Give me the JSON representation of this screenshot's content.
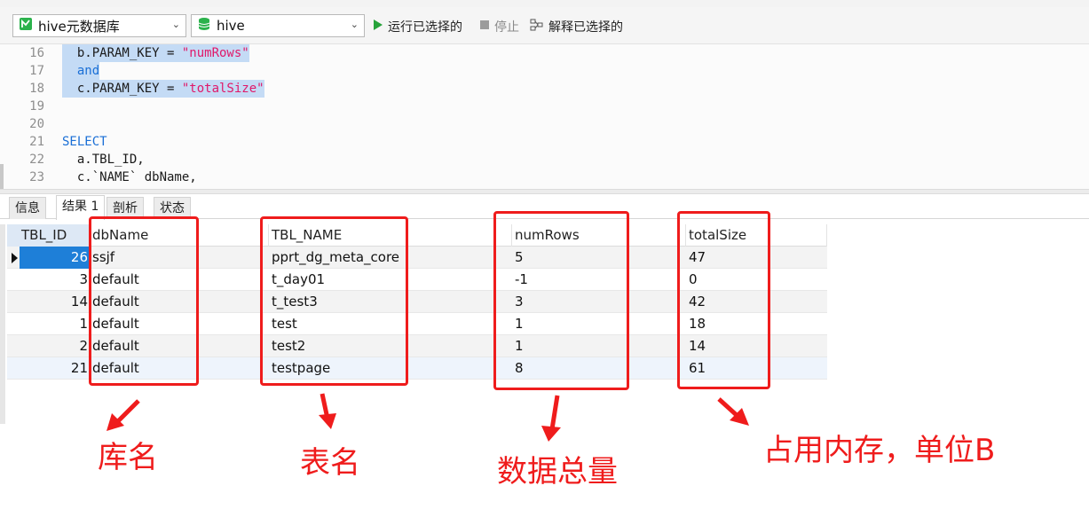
{
  "toolbar": {
    "connection_name": "hive元数据库",
    "database_name": "hive",
    "run_selected_label": "运行已选择的",
    "stop_label": "停止",
    "explain_selected_label": "解释已选择的"
  },
  "editor": {
    "lines": [
      {
        "num": "16",
        "parts": [
          {
            "t": "  b.PARAM_KEY = ",
            "c": ""
          },
          {
            "t": "\"numRows\"",
            "c": "str"
          }
        ],
        "highlight": true
      },
      {
        "num": "17",
        "parts": [
          {
            "t": "  and",
            "c": "kw"
          }
        ],
        "highlight": true
      },
      {
        "num": "18",
        "parts": [
          {
            "t": "  c.PARAM_KEY = ",
            "c": ""
          },
          {
            "t": "\"totalSize\"",
            "c": "str"
          }
        ],
        "highlight": true
      },
      {
        "num": "19",
        "parts": [],
        "highlight": false
      },
      {
        "num": "20",
        "parts": [],
        "highlight": false
      },
      {
        "num": "21",
        "parts": [
          {
            "t": "SELECT",
            "c": "kw"
          }
        ],
        "highlight": false
      },
      {
        "num": "22",
        "parts": [
          {
            "t": "  a.TBL_ID,",
            "c": ""
          }
        ],
        "highlight": false
      },
      {
        "num": "23",
        "parts": [
          {
            "t": "  c.`NAME` dbName,",
            "c": ""
          }
        ],
        "highlight": false
      }
    ]
  },
  "tabs": [
    "信息",
    "结果 1",
    "剖析",
    "状态"
  ],
  "active_tab": "结果 1",
  "grid": {
    "columns": [
      "TBL_ID",
      "dbName",
      "TBL_NAME",
      "numRows",
      "totalSize"
    ],
    "rows": [
      {
        "TBL_ID": "26",
        "dbName": "ssjf",
        "TBL_NAME": "pprt_dg_meta_core",
        "numRows": "5",
        "totalSize": "47"
      },
      {
        "TBL_ID": "3",
        "dbName": "default",
        "TBL_NAME": "t_day01",
        "numRows": "-1",
        "totalSize": "0"
      },
      {
        "TBL_ID": "14",
        "dbName": "default",
        "TBL_NAME": "t_test3",
        "numRows": "3",
        "totalSize": "42"
      },
      {
        "TBL_ID": "1",
        "dbName": "default",
        "TBL_NAME": "test",
        "numRows": "1",
        "totalSize": "18"
      },
      {
        "TBL_ID": "2",
        "dbName": "default",
        "TBL_NAME": "test2",
        "numRows": "1",
        "totalSize": "14"
      },
      {
        "TBL_ID": "21",
        "dbName": "default",
        "TBL_NAME": "testpage",
        "numRows": "8",
        "totalSize": "61"
      }
    ],
    "selected_row": 0
  },
  "annotations": {
    "db_name_label": "库名",
    "table_name_label": "表名",
    "row_count_label": "数据总量",
    "size_label": "占用内存，单位B"
  },
  "colors": {
    "annotation_red": "#ef1c1c",
    "keyword_blue": "#1a6fd6",
    "string_pink": "#e0196a",
    "selection_blue": "#1e7fd8",
    "highlight_bg": "#c4dbf5"
  }
}
